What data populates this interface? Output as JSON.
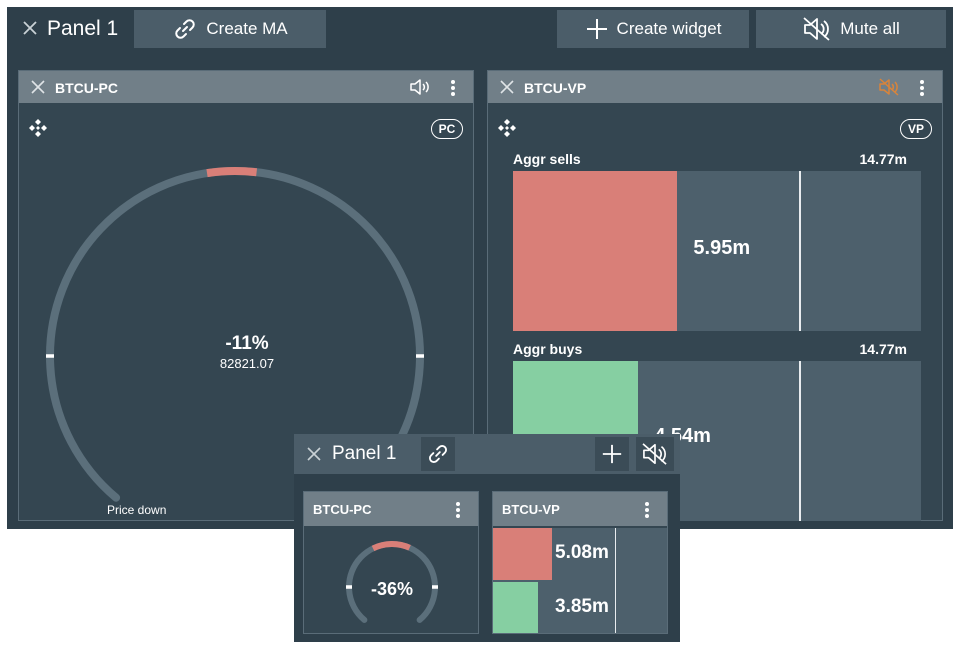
{
  "header": {
    "title": "Panel 1",
    "create_ma_label": "Create MA",
    "create_widget_label": "Create widget",
    "mute_all_label": "Mute all"
  },
  "widgets": {
    "pc": {
      "title": "BTCU-PC",
      "badge": "PC",
      "percent": "-11%",
      "price": "82821.07",
      "status": "Price down",
      "progress": 0.11
    },
    "vp": {
      "title": "BTCU-VP",
      "badge": "VP",
      "sells_label": "Aggr sells",
      "sells_total": "14.77m",
      "sells_value": "5.95m",
      "sells_fill": 0.403,
      "buys_label": "Aggr buys",
      "buys_total": "14.77m",
      "buys_value": "4.54m",
      "buys_fill": 0.307,
      "marker": 0.7
    }
  },
  "mini_panel": {
    "title": "Panel 1",
    "pc": {
      "title": "BTCU-PC",
      "percent": "-36%",
      "progress": 0.36
    },
    "vp": {
      "title": "BTCU-VP",
      "sells_value": "5.08m",
      "buys_value": "3.85m",
      "sells_fill": 0.34,
      "buys_fill": 0.26,
      "marker": 0.7
    }
  },
  "colors": {
    "sell": "#d97f78",
    "buy": "#86cfa2",
    "muted_alert": "#d9843a"
  },
  "icons": {
    "close": "close-icon",
    "link": "link-icon",
    "plus": "plus-icon",
    "mute": "mute-icon",
    "speaker": "speaker-icon",
    "exchange": "binance-icon",
    "menu": "kebab-menu-icon"
  }
}
